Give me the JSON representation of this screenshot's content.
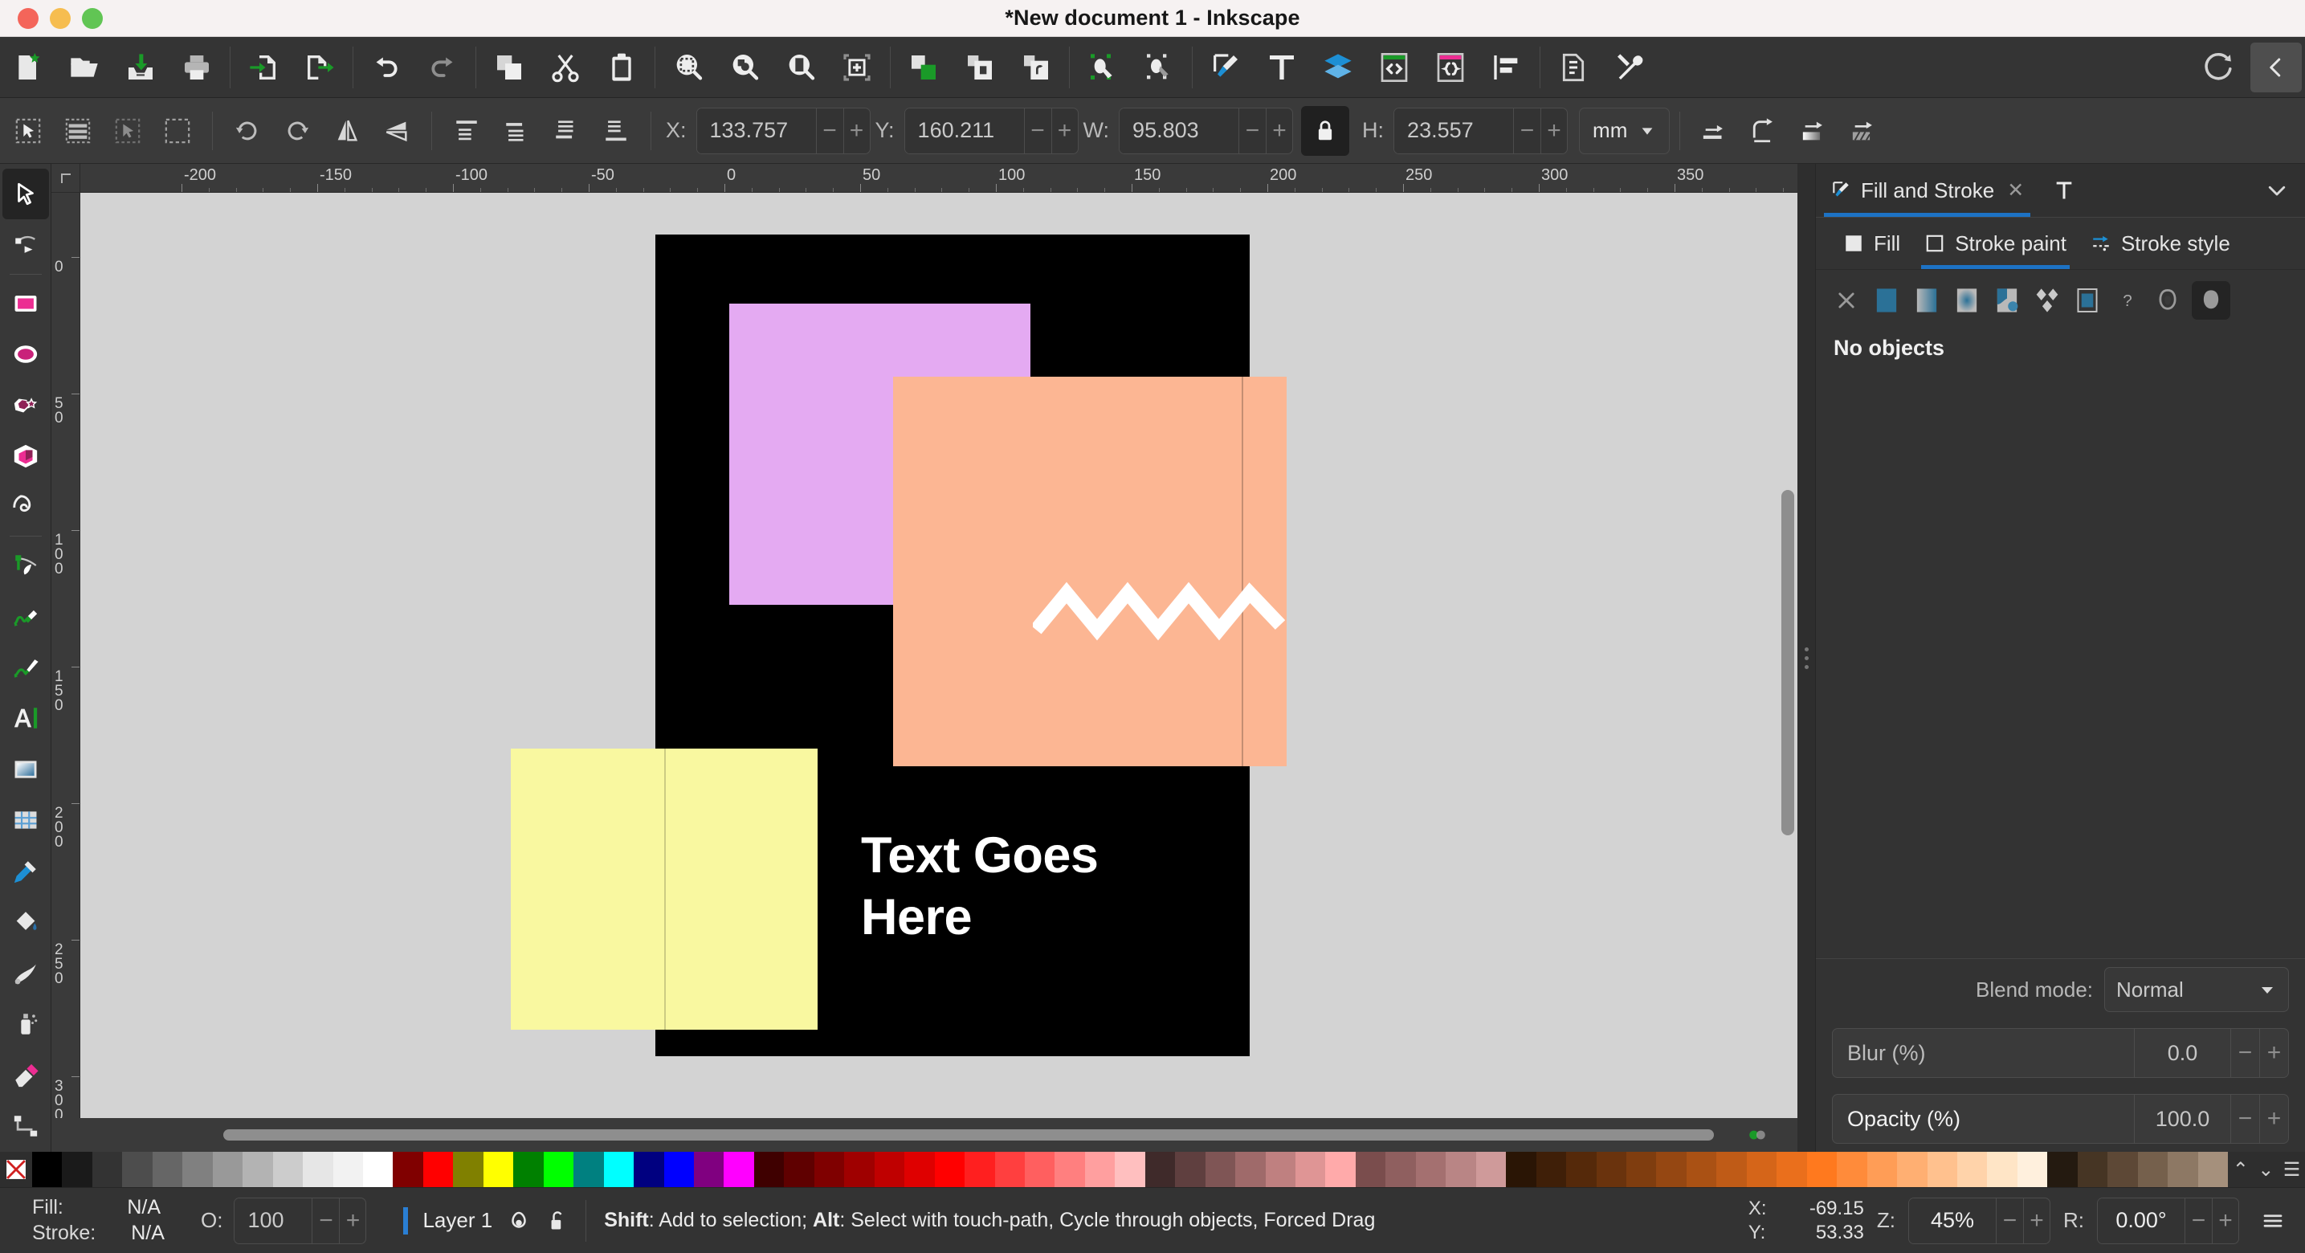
{
  "window": {
    "title": "*New document 1 - Inkscape",
    "traffic_lights": [
      "close",
      "minimize",
      "maximize"
    ]
  },
  "command_toolbar": {
    "groups": [
      {
        "buttons": [
          {
            "name": "new-document-button",
            "icon": "document-new-icon",
            "label": "New"
          },
          {
            "name": "open-document-button",
            "icon": "folder-open-icon",
            "label": "Open"
          },
          {
            "name": "save-document-button",
            "icon": "save-icon",
            "label": "Save"
          },
          {
            "name": "print-document-button",
            "icon": "printer-icon",
            "label": "Print"
          }
        ]
      },
      {
        "buttons": [
          {
            "name": "import-button",
            "icon": "document-import-icon",
            "label": "Import"
          },
          {
            "name": "export-button",
            "icon": "document-export-icon",
            "label": "Export"
          }
        ]
      },
      {
        "buttons": [
          {
            "name": "undo-button",
            "icon": "undo-arrow-icon",
            "label": "Undo"
          },
          {
            "name": "redo-button",
            "icon": "redo-arrow-icon",
            "label": "Redo"
          }
        ]
      },
      {
        "buttons": [
          {
            "name": "copy-button",
            "icon": "copy-icon",
            "label": "Copy"
          },
          {
            "name": "cut-button",
            "icon": "scissors-icon",
            "label": "Cut"
          },
          {
            "name": "paste-button",
            "icon": "clipboard-icon",
            "label": "Paste"
          }
        ]
      },
      {
        "buttons": [
          {
            "name": "zoom-selection-button",
            "icon": "zoom-selection-icon",
            "label": "Zoom to selection"
          },
          {
            "name": "zoom-drawing-button",
            "icon": "zoom-drawing-icon",
            "label": "Zoom to drawing"
          },
          {
            "name": "zoom-page-button",
            "icon": "zoom-page-icon",
            "label": "Zoom to page"
          },
          {
            "name": "new-page-button",
            "icon": "page-add-icon",
            "label": "New page"
          }
        ]
      },
      {
        "buttons": [
          {
            "name": "duplicate-button",
            "icon": "duplicate-icon",
            "label": "Duplicate"
          },
          {
            "name": "group-button",
            "icon": "group-icon",
            "label": "Group"
          },
          {
            "name": "ungroup-button",
            "icon": "ungroup-icon",
            "label": "Ungroup"
          }
        ]
      },
      {
        "buttons": [
          {
            "name": "show-clip-button",
            "icon": "clip-icon",
            "label": "Clip"
          },
          {
            "name": "show-mask-button",
            "icon": "mask-icon",
            "label": "Mask"
          }
        ]
      },
      {
        "buttons": [
          {
            "name": "fill-and-stroke-dialog-button",
            "icon": "fill-stroke-brush-icon",
            "label": "Fill and Stroke"
          },
          {
            "name": "text-and-font-dialog-button",
            "icon": "text-icon",
            "label": "Text and Font"
          },
          {
            "name": "layers-dialog-button",
            "icon": "layers-icon",
            "label": "Layers"
          },
          {
            "name": "xml-editor-button",
            "icon": "xml-code-icon",
            "label": "XML Editor"
          },
          {
            "name": "selectors-dialog-button",
            "icon": "css-braces-icon",
            "label": "Selectors and CSS"
          },
          {
            "name": "align-dialog-button",
            "icon": "align-icon",
            "label": "Align and Distribute"
          }
        ]
      },
      {
        "buttons": [
          {
            "name": "document-properties-button",
            "icon": "document-properties-icon",
            "label": "Document Properties"
          },
          {
            "name": "preferences-button",
            "icon": "wrench-screwdriver-icon",
            "label": "Preferences"
          }
        ]
      }
    ],
    "right": [
      {
        "name": "command-palette-button",
        "icon": "rotate-refresh-icon",
        "label": "Command Palette"
      },
      {
        "name": "panel-collapse-button",
        "icon": "chevron-left-icon",
        "label": "Collapse panel"
      }
    ]
  },
  "tool_controls": {
    "left_buttons": [
      {
        "name": "select-all-button",
        "icon": "select-all-icon"
      },
      {
        "name": "select-all-layers-button",
        "icon": "select-all-layers-icon"
      },
      {
        "name": "deselect-button",
        "icon": "deselect-icon"
      },
      {
        "name": "select-same-button",
        "icon": "select-same-icon"
      }
    ],
    "transform_buttons": [
      {
        "name": "rotate-ccw-button",
        "icon": "rotate-ccw-icon"
      },
      {
        "name": "rotate-cw-button",
        "icon": "rotate-cw-icon"
      },
      {
        "name": "flip-horizontal-button",
        "icon": "flip-horizontal-icon"
      },
      {
        "name": "flip-vertical-button",
        "icon": "flip-vertical-icon"
      }
    ],
    "zorder_buttons": [
      {
        "name": "raise-to-top-button",
        "icon": "raise-to-top-icon"
      },
      {
        "name": "raise-button",
        "icon": "raise-icon"
      },
      {
        "name": "lower-button",
        "icon": "lower-icon"
      },
      {
        "name": "lower-to-bottom-button",
        "icon": "lower-to-bottom-icon"
      }
    ],
    "fields": [
      {
        "name": "x-field",
        "label": "X:",
        "value": "133.757"
      },
      {
        "name": "y-field",
        "label": "Y:",
        "value": "160.211"
      },
      {
        "name": "width-field",
        "label": "W:",
        "value": "95.803"
      },
      {
        "name": "height-field",
        "label": "H:",
        "value": "23.557"
      }
    ],
    "lock_ratio": {
      "name": "lock-wh-ratio-button",
      "icon": "lock-closed-icon",
      "locked": true
    },
    "units": {
      "name": "units-selector",
      "value": "mm"
    },
    "affect_buttons": [
      {
        "name": "affect-stroke-width-button",
        "icon": "scale-stroke-icon"
      },
      {
        "name": "affect-rounded-corners-button",
        "icon": "scale-corners-icon"
      },
      {
        "name": "affect-gradients-button",
        "icon": "scale-gradients-icon"
      },
      {
        "name": "affect-patterns-button",
        "icon": "scale-patterns-icon"
      }
    ]
  },
  "toolbox": {
    "tools": [
      {
        "name": "selector-tool",
        "icon": "cursor-arrow-icon",
        "label": "Selector",
        "active": true
      },
      {
        "name": "node-tool",
        "icon": "node-editor-icon",
        "label": "Node"
      },
      {
        "name": "rectangle-tool",
        "icon": "rectangle-icon",
        "label": "Rectangle"
      },
      {
        "name": "ellipse-tool",
        "icon": "ellipse-icon",
        "label": "Ellipse"
      },
      {
        "name": "star-tool",
        "icon": "star-polygon-icon",
        "label": "Star / Polygon"
      },
      {
        "name": "3dbox-tool",
        "icon": "cube-3d-icon",
        "label": "3D Box"
      },
      {
        "name": "spiral-tool",
        "icon": "spiral-icon",
        "label": "Spiral"
      },
      {
        "name": "pen-tool",
        "icon": "bezier-pen-icon",
        "label": "Pen / Bezier"
      },
      {
        "name": "pencil-tool",
        "icon": "pencil-icon",
        "label": "Pencil"
      },
      {
        "name": "calligraphy-tool",
        "icon": "calligraphy-brush-icon",
        "label": "Calligraphy"
      },
      {
        "name": "text-tool",
        "icon": "text-a-icon",
        "label": "Text"
      },
      {
        "name": "gradient-tool",
        "icon": "gradient-square-icon",
        "label": "Gradient"
      },
      {
        "name": "mesh-tool",
        "icon": "mesh-gradient-icon",
        "label": "Mesh"
      },
      {
        "name": "dropper-tool",
        "icon": "eyedropper-icon",
        "label": "Dropper"
      },
      {
        "name": "paint-bucket-tool",
        "icon": "paint-bucket-icon",
        "label": "Paint Bucket"
      },
      {
        "name": "tweak-tool",
        "icon": "tweak-icon",
        "label": "Tweak"
      },
      {
        "name": "spray-tool",
        "icon": "spray-can-icon",
        "label": "Spray"
      },
      {
        "name": "eraser-tool",
        "icon": "eraser-icon",
        "label": "Eraser"
      },
      {
        "name": "connector-tool",
        "icon": "connector-icon",
        "label": "Connector"
      }
    ]
  },
  "canvas": {
    "h_ruler_labels": [
      "-200",
      "-150",
      "-100",
      "-50",
      "0",
      "50",
      "100",
      "150",
      "200",
      "250",
      "300",
      "350"
    ],
    "v_ruler_labels": [
      "0",
      "50",
      "100",
      "150",
      "200",
      "250",
      "300"
    ],
    "artwork": {
      "background_color": "#000000",
      "text": "Text Goes Here",
      "shapes": [
        {
          "name": "violet-square",
          "color": "#e4aaf2"
        },
        {
          "name": "peach-square",
          "color": "#fcb693"
        },
        {
          "name": "yellow-square",
          "color": "#f9f8a0"
        },
        {
          "name": "zigzag-path",
          "color": "#ffffff"
        }
      ]
    },
    "rotation_badge": "rotation-lock-icon"
  },
  "dock": {
    "tabs": [
      {
        "name": "tab-fill-and-stroke",
        "label": "Fill and Stroke",
        "icon": "fill-stroke-brush-icon",
        "active": true,
        "closable": true
      },
      {
        "name": "tab-text-and-font",
        "label": "",
        "icon": "text-icon",
        "active": false,
        "closable": false
      }
    ],
    "collapse_icon": "chevron-down-icon",
    "fill_stroke": {
      "subtabs": [
        {
          "name": "subtab-fill",
          "label": "Fill",
          "icon": "fill-swatch-icon",
          "active": false
        },
        {
          "name": "subtab-stroke-paint",
          "label": "Stroke paint",
          "icon": "stroke-swatch-icon",
          "active": true
        },
        {
          "name": "subtab-stroke-style",
          "label": "Stroke style",
          "icon": "stroke-style-icon",
          "active": false
        }
      ],
      "paint_types": [
        {
          "name": "paint-none-button",
          "icon": "x-icon"
        },
        {
          "name": "paint-flat-color-button",
          "icon": "flat-color-icon"
        },
        {
          "name": "paint-linear-gradient-button",
          "icon": "linear-gradient-icon"
        },
        {
          "name": "paint-radial-gradient-button",
          "icon": "radial-gradient-icon"
        },
        {
          "name": "paint-mesh-gradient-button",
          "icon": "mesh-gradient-icon"
        },
        {
          "name": "paint-pattern-button",
          "icon": "pattern-icon"
        },
        {
          "name": "paint-swatch-button",
          "icon": "swatch-icon"
        },
        {
          "name": "paint-unknown-button",
          "icon": "question-mark-icon"
        },
        {
          "name": "stroke-markers-open-button",
          "icon": "shape-outline-icon"
        },
        {
          "name": "stroke-markers-filled-button",
          "icon": "shape-filled-icon",
          "selected": true
        }
      ],
      "status_text": "No objects",
      "blend_mode": {
        "label": "Blend mode:",
        "value": "Normal"
      },
      "blur": {
        "label": "Blur (%)",
        "value": "0.0"
      },
      "opacity": {
        "label": "Opacity (%)",
        "value": "100.0"
      }
    }
  },
  "palette": {
    "none_swatch": "no-color-icon",
    "colors": [
      "#000000",
      "#1a1a1a",
      "#333333",
      "#4d4d4d",
      "#666666",
      "#808080",
      "#999999",
      "#b3b3b3",
      "#cccccc",
      "#e6e6e6",
      "#f2f2f2",
      "#ffffff",
      "#800000",
      "#ff0000",
      "#808000",
      "#ffff00",
      "#008000",
      "#00ff00",
      "#008080",
      "#00ffff",
      "#000080",
      "#0000ff",
      "#800080",
      "#ff00ff",
      "#3f0000",
      "#5f0000",
      "#7f0000",
      "#9f0000",
      "#bf0000",
      "#df0000",
      "#ff0000",
      "#ff1f1f",
      "#ff3f3f",
      "#ff5f5f",
      "#ff7f7f",
      "#ff9f9f",
      "#ffbfbf",
      "#3f2a2a",
      "#5f3f3f",
      "#7f5555",
      "#9f6a6a",
      "#bf8080",
      "#df9595",
      "#ffaaaa",
      "#7a4d4d",
      "#8f5f5f",
      "#a47070",
      "#b98585",
      "#cf9a9a",
      "#2a1505",
      "#3f1f08",
      "#55290a",
      "#6a330d",
      "#7f3d0f",
      "#954712",
      "#aa5114",
      "#bf5b17",
      "#d56519",
      "#ea6f1c",
      "#ff791e",
      "#ff8b3a",
      "#ff9d56",
      "#ffaf72",
      "#ffc18e",
      "#ffd3aa",
      "#ffe5c6",
      "#fff0dd",
      "#241a10",
      "#463524",
      "#5d4836",
      "#75604c",
      "#8d7864",
      "#a5907c"
    ],
    "scroll_up_icon": "chevron-up-icon",
    "scroll_down_icon": "chevron-down-icon",
    "menu_icon": "hamburger-menu-icon"
  },
  "statusbar": {
    "fill_label": "Fill:",
    "fill_value": "N/A",
    "stroke_label": "Stroke:",
    "stroke_value": "N/A",
    "opacity_label": "O:",
    "opacity_value": "100",
    "layer_name": "Layer 1",
    "layer_visibility_icon": "eye-icon",
    "layer_lock_icon": "unlock-icon",
    "hint_prefix": "Shift",
    "hint_mid": ": Add to selection; ",
    "hint_bold2": "Alt",
    "hint_suffix": ": Select with touch-path, Cycle through objects, Forced Drag",
    "coord_x_label": "X:",
    "coord_x_value": "-69.15",
    "coord_y_label": "Y:",
    "coord_y_value": "53.33",
    "zoom_label": "Z:",
    "zoom_value": "45%",
    "rotation_label": "R:",
    "rotation_value": "0.00°",
    "menu_icon": "hamburger-menu-icon"
  }
}
